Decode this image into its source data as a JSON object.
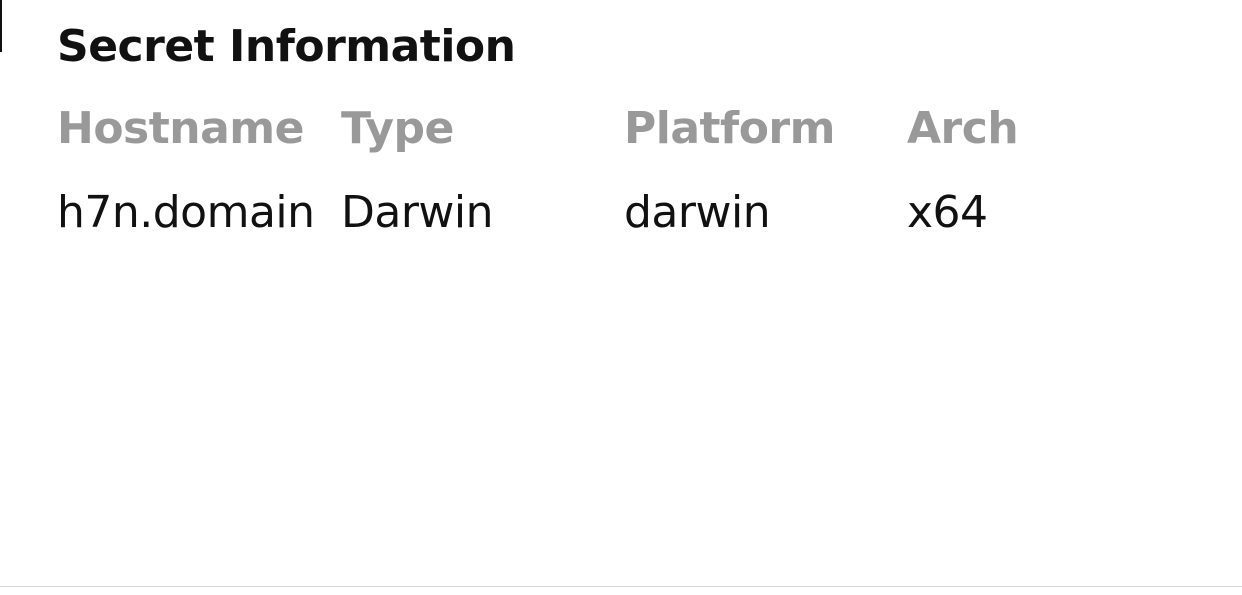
{
  "panel": {
    "title": "Secret Information"
  },
  "table": {
    "headers": {
      "hostname": "Hostname",
      "type": "Type",
      "platform": "Platform",
      "arch": "Arch"
    },
    "rows": [
      {
        "hostname": "h7n.domain",
        "type": "Darwin",
        "platform": "darwin",
        "arch": "x64"
      }
    ]
  },
  "colors": {
    "title_text": "#111111",
    "header_text": "#999999",
    "cell_text": "#111111",
    "divider": "#d8d8d8"
  }
}
